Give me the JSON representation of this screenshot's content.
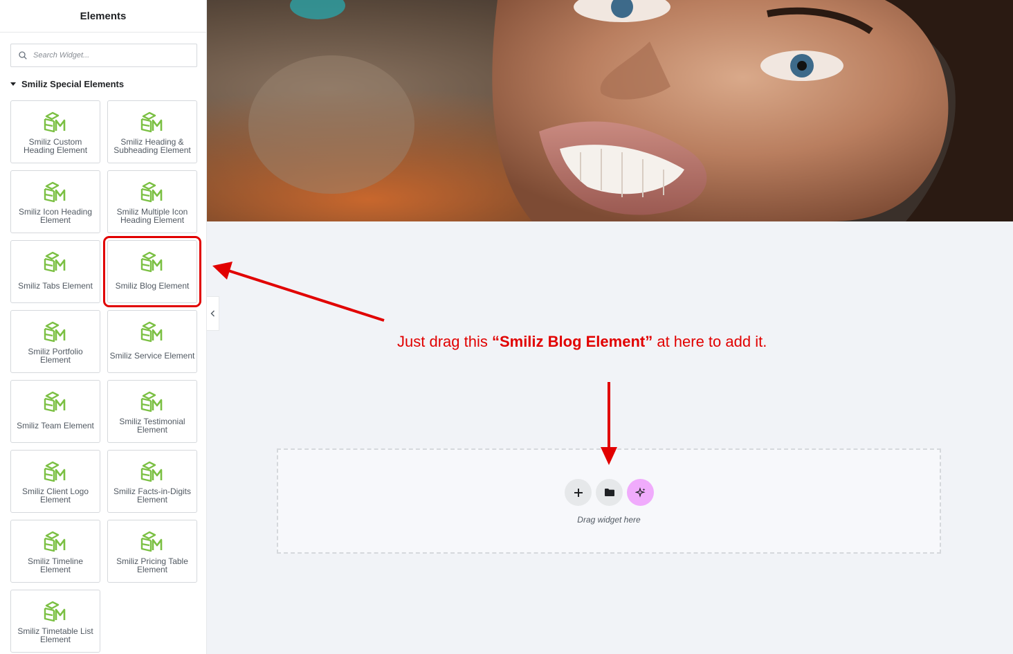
{
  "sidebar": {
    "title": "Elements",
    "search": {
      "placeholder": "Search Widget..."
    },
    "category": "Smiliz Special Elements",
    "widgets": [
      {
        "label": "Smiliz Custom Heading Element"
      },
      {
        "label": "Smiliz Heading & Subheading Element"
      },
      {
        "label": "Smiliz Icon Heading Element"
      },
      {
        "label": "Smiliz Multiple Icon Heading Element"
      },
      {
        "label": "Smiliz Tabs Element"
      },
      {
        "label": "Smiliz Blog Element"
      },
      {
        "label": "Smiliz Portfolio Element"
      },
      {
        "label": "Smiliz Service Element"
      },
      {
        "label": "Smiliz Team Element"
      },
      {
        "label": "Smiliz Testimonial Element"
      },
      {
        "label": "Smiliz Client Logo Element"
      },
      {
        "label": "Smiliz Facts-in-Digits Element"
      },
      {
        "label": "Smiliz Timeline Element"
      },
      {
        "label": "Smiliz Pricing Table Element"
      },
      {
        "label": "Smiliz Timetable List Element"
      }
    ],
    "widget_icon": "smiliz-logo-icon",
    "collapse_icon": "chevron-left-icon"
  },
  "annotation": {
    "prefix": "Just drag this ",
    "highlight": "“Smiliz Blog Element”",
    "suffix": " at here to add it.",
    "color": "#e10000"
  },
  "dropzone": {
    "buttons": [
      "plus-icon",
      "folder-icon",
      "ai-sparkle-icon"
    ],
    "text": "Drag widget here"
  },
  "colors": {
    "logo_green": "#7bc043",
    "annotation_red": "#e10000",
    "ai_button": "#f0abfc"
  }
}
